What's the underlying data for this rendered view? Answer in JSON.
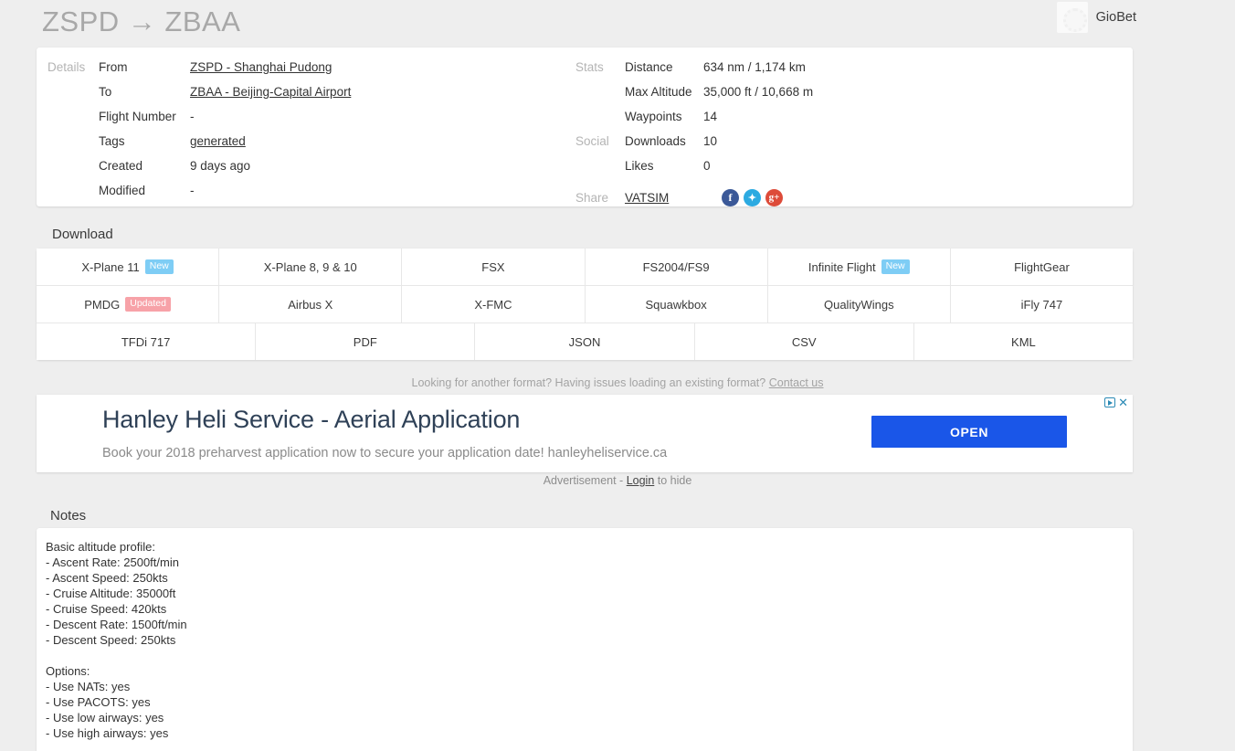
{
  "header": {
    "route_title": "ZSPD → ZBAA",
    "brand_name": "GioBet"
  },
  "details": {
    "group_label": "Details",
    "rows": [
      {
        "label": "From",
        "value": "ZSPD - Shanghai Pudong",
        "link": true
      },
      {
        "label": "To",
        "value": "ZBAA - Beijing-Capital Airport",
        "link": true
      },
      {
        "label": "Flight Number",
        "value": "-",
        "link": false
      },
      {
        "label": "Tags",
        "value": "generated",
        "link": true
      },
      {
        "label": "Created",
        "value": "9 days ago",
        "link": false
      },
      {
        "label": "Modified",
        "value": "-",
        "link": false
      }
    ]
  },
  "stats": {
    "group_label": "Stats",
    "rows": [
      {
        "label": "Distance",
        "value": "634 nm / 1,174 km"
      },
      {
        "label": "Max Altitude",
        "value": "35,000 ft / 10,668 m"
      },
      {
        "label": "Waypoints",
        "value": "14"
      }
    ]
  },
  "social": {
    "group_label": "Social",
    "rows": [
      {
        "label": "Downloads",
        "value": "10"
      },
      {
        "label": "Likes",
        "value": "0"
      }
    ]
  },
  "share": {
    "group_label": "Share",
    "vatsim_label": "VATSIM",
    "icons": [
      {
        "name": "facebook-icon",
        "glyph": "f",
        "color": "#3b5998"
      },
      {
        "name": "twitter-icon",
        "glyph": "✦",
        "color": "#2caae1"
      },
      {
        "name": "googleplus-icon",
        "glyph": "g+",
        "color": "#dd4b39"
      }
    ]
  },
  "download": {
    "heading": "Download",
    "rows": [
      [
        {
          "label": "X-Plane 11",
          "badge": "New"
        },
        {
          "label": "X-Plane 8, 9 & 10",
          "badge": ""
        },
        {
          "label": "FSX",
          "badge": ""
        },
        {
          "label": "FS2004/FS9",
          "badge": ""
        },
        {
          "label": "Infinite Flight",
          "badge": "New"
        },
        {
          "label": "FlightGear",
          "badge": ""
        }
      ],
      [
        {
          "label": "PMDG",
          "badge": "Updated"
        },
        {
          "label": "Airbus X",
          "badge": ""
        },
        {
          "label": "X-FMC",
          "badge": ""
        },
        {
          "label": "Squawkbox",
          "badge": ""
        },
        {
          "label": "QualityWings",
          "badge": ""
        },
        {
          "label": "iFly 747",
          "badge": ""
        }
      ],
      [
        {
          "label": "TFDi 717",
          "badge": ""
        },
        {
          "label": "PDF",
          "badge": ""
        },
        {
          "label": "JSON",
          "badge": ""
        },
        {
          "label": "CSV",
          "badge": ""
        },
        {
          "label": "KML",
          "badge": ""
        }
      ]
    ],
    "note_text": "Looking for another format? Having issues loading an existing format? ",
    "note_link": "Contact us"
  },
  "advertisement": {
    "headline": "Hanley Heli Service - Aerial Application",
    "subtext": "Book your 2018 preharvest application now to secure your application date! hanleyheliservice.ca",
    "open_label": "OPEN",
    "close_glyph": "✕",
    "label_prefix": "Advertisement - ",
    "label_link": "Login",
    "label_suffix": " to hide"
  },
  "notes": {
    "heading": "Notes",
    "body": "Basic altitude profile:\n- Ascent Rate: 2500ft/min\n- Ascent Speed: 250kts\n- Cruise Altitude: 35000ft\n- Cruise Speed: 420kts\n- Descent Rate: 1500ft/min\n- Descent Speed: 250kts\n\nOptions:\n- Use NATs: yes\n- Use PACOTS: yes\n- Use low airways: yes\n- Use high airways: yes"
  }
}
